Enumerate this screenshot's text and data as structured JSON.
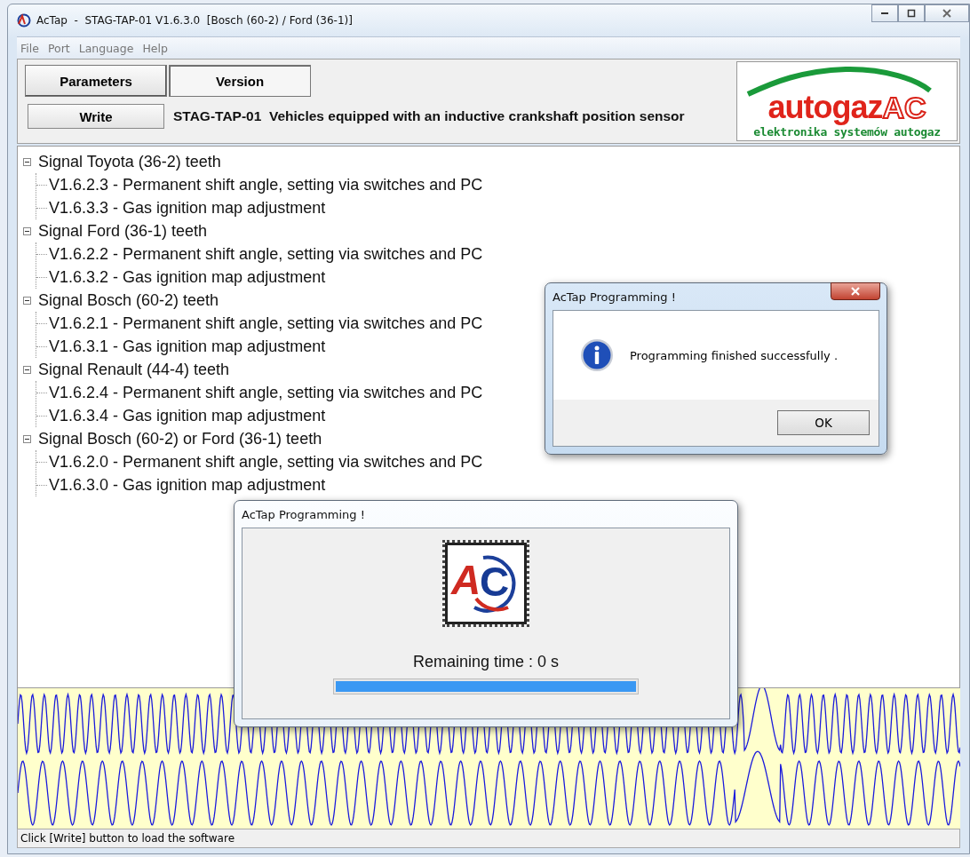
{
  "window": {
    "title": "AcTap  -  STAG-TAP-01 V1.6.3.0  [Bosch (60-2) / Ford (36-1)]"
  },
  "menu": [
    "File",
    "Port",
    "Language",
    "Help"
  ],
  "tabs": [
    {
      "label": "Parameters",
      "selected": false
    },
    {
      "label": "Version",
      "selected": true
    }
  ],
  "write_button": "Write",
  "description": "STAG-TAP-01  Vehicles equipped with an inductive crankshaft position sensor",
  "logo": {
    "brand": "autogaz",
    "mark": "AC",
    "tagline": "elektronika systemów autogaz"
  },
  "tree": [
    {
      "label": "Signal Toyota (36-2) teeth",
      "expanded": true,
      "children": [
        {
          "label": "V1.6.2.3 - Permanent shift angle, setting via switches and PC"
        },
        {
          "label": "V1.6.3.3 - Gas ignition map adjustment"
        }
      ]
    },
    {
      "label": "Signal Ford (36-1) teeth",
      "expanded": true,
      "children": [
        {
          "label": "V1.6.2.2 - Permanent shift angle, setting via switches and PC"
        },
        {
          "label": "V1.6.3.2 - Gas ignition map adjustment"
        }
      ]
    },
    {
      "label": "Signal Bosch (60-2) teeth",
      "expanded": true,
      "children": [
        {
          "label": "V1.6.2.1 - Permanent shift angle, setting via switches and PC"
        },
        {
          "label": "V1.6.3.1 - Gas ignition map adjustment"
        }
      ]
    },
    {
      "label": "Signal Renault (44-4) teeth",
      "expanded": true,
      "children": [
        {
          "label": "V1.6.2.4 - Permanent shift angle, setting via switches and PC"
        },
        {
          "label": "V1.6.3.4 - Gas ignition map adjustment"
        }
      ]
    },
    {
      "label": "Signal Bosch (60-2) or Ford (36-1) teeth",
      "expanded": true,
      "children": [
        {
          "label": "V1.6.2.0 - Permanent shift angle, setting via switches and PC"
        },
        {
          "label": "V1.6.3.0 - Gas ignition map adjustment"
        }
      ]
    }
  ],
  "status_bar": "Click [Write] button to load the software",
  "success_dialog": {
    "title": "AcTap Programming !",
    "message": "Programming finished successfully .",
    "button": "OK"
  },
  "progress_dialog": {
    "title": "AcTap Programming !",
    "mark_letters": [
      "A",
      "C"
    ],
    "remaining": "Remaining time : 0 s",
    "level": 1
  }
}
